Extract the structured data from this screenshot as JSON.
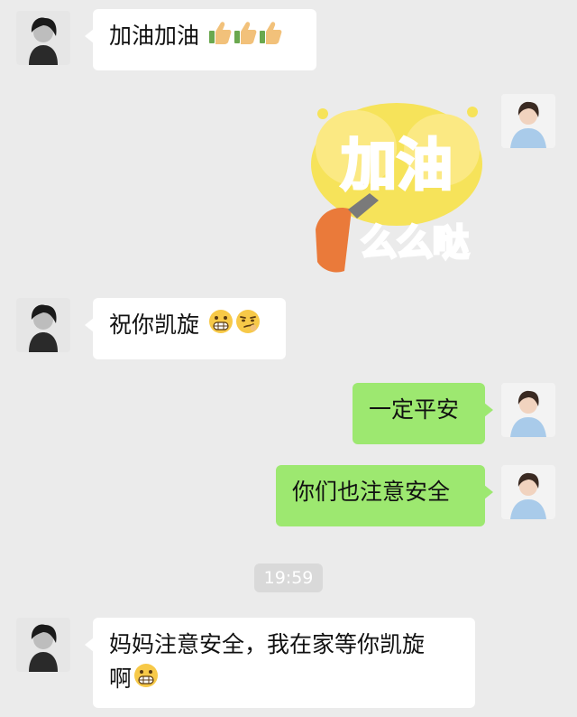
{
  "messages": {
    "m1": {
      "text": "加油加油"
    },
    "sticker": {
      "top_text": "加油",
      "bottom_text": "么么哒"
    },
    "m2": {
      "text": "祝你凯旋"
    },
    "m3": {
      "text": "一定平安"
    },
    "m4": {
      "text": "你们也注意安全"
    },
    "timestamp": "19:59",
    "m5": {
      "line1": "妈妈注意安全，我在家等你凯旋",
      "line2": "啊"
    }
  },
  "icons": [
    "thumbs-up-icon",
    "grimace-emoji-icon",
    "smirk-emoji-icon"
  ],
  "colors": {
    "background": "#ebebeb",
    "incoming_bubble": "#ffffff",
    "outgoing_bubble": "#9de870",
    "timestamp_badge": "#d9d9d9"
  }
}
